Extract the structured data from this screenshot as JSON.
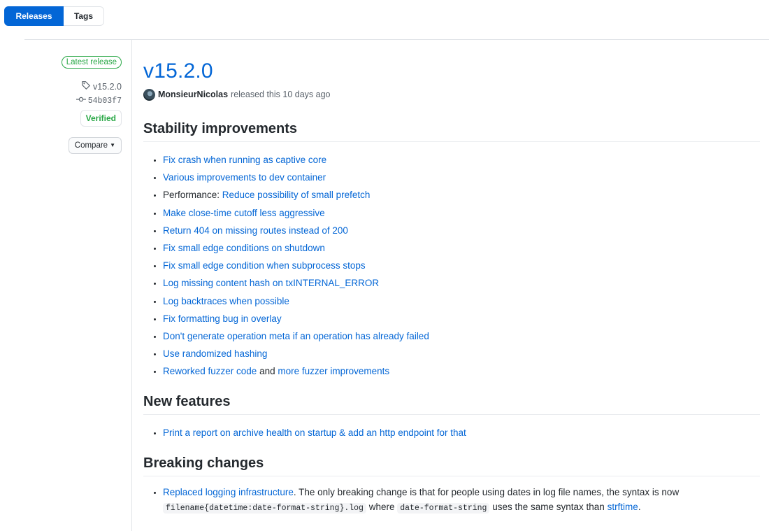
{
  "tabs": {
    "releases": "Releases",
    "tags": "Tags"
  },
  "sidebar": {
    "latest_badge": "Latest release",
    "tag": "v15.2.0",
    "commit": "54b03f7",
    "verified": "Verified",
    "compare": "Compare"
  },
  "release": {
    "title": "v15.2.0",
    "author": "MonsieurNicolas",
    "released_text": "released this 10 days ago"
  },
  "sections": {
    "stability": {
      "heading": "Stability improvements",
      "items": [
        "Fix crash when running as captive core",
        "Various improvements to dev container",
        "Reduce possibility of small prefetch",
        "Make close-time cutoff less aggressive",
        "Return 404 on missing routes instead of 200",
        "Fix small edge conditions on shutdown",
        "Fix small edge condition when subprocess stops",
        "Log missing content hash on txINTERNAL_ERROR",
        "Log backtraces when possible",
        "Fix formatting bug in overlay",
        "Don't generate operation meta if an operation has already failed",
        "Use randomized hashing"
      ],
      "performance_prefix": "Performance: ",
      "fuzzer_link_1": "Reworked fuzzer code",
      "fuzzer_and": " and ",
      "fuzzer_link_2": "more fuzzer improvements"
    },
    "new_features": {
      "heading": "New features",
      "items": [
        "Print a report on archive health on startup & add an http endpoint for that"
      ]
    },
    "breaking": {
      "heading": "Breaking changes",
      "link": "Replaced logging infrastructure",
      "text1": ". The only breaking change is that for people using dates in log file names, the syntax is now",
      "code1": "filename{datetime:date-format-string}.log",
      "text2": " where ",
      "code2": "date-format-string",
      "text3": " uses the same syntax than ",
      "link2": "strftime",
      "text4": "."
    }
  },
  "colors": {
    "link": "#0366d6",
    "verified": "#28a745",
    "primary_tab": "#0366d6"
  }
}
